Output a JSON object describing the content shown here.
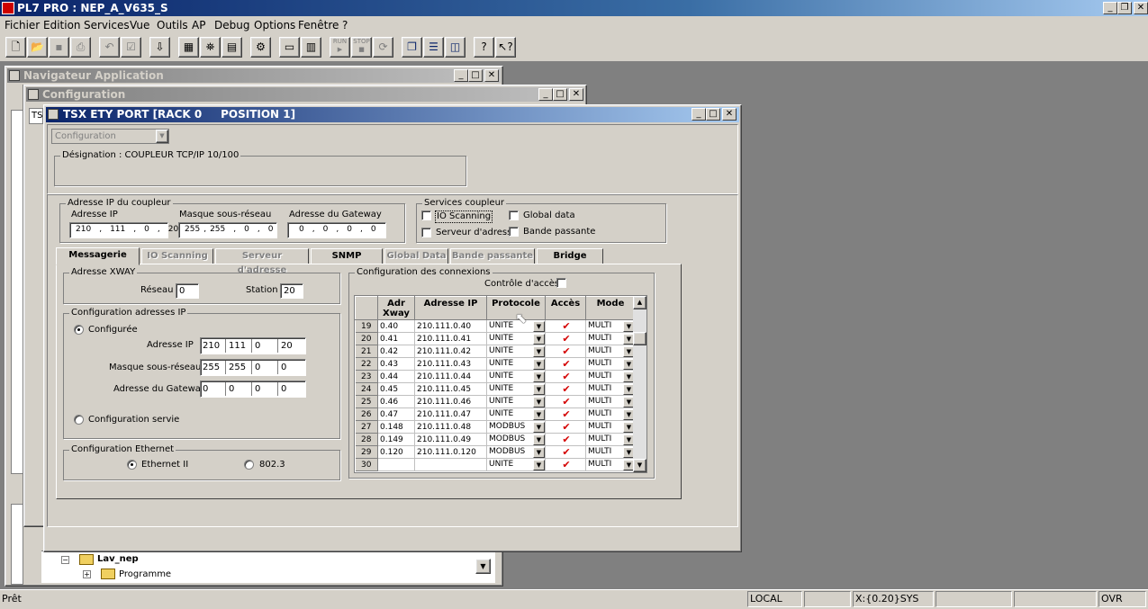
{
  "app": {
    "title": "PL7 PRO : NEP_A_V635_S"
  },
  "menu": [
    "Fichier",
    "Edition",
    "Services",
    "Vue",
    "Outils",
    "AP",
    "Debug",
    "Options",
    "Fenêtre",
    "?"
  ],
  "toolbar": {
    "run": "RUN",
    "stop": "STOP"
  },
  "nav_window": {
    "title": "Navigateur Application",
    "tree_root": "Lav_nep",
    "tree_child": "Programme",
    "cut_text": "TS"
  },
  "config_window": {
    "title": "Configuration"
  },
  "dialog": {
    "title": "TSX ETY PORT [RACK 0     POSITION 1]",
    "config_select": "Configuration",
    "designation": "Désignation : COUPLEUR TCP/IP 10/100",
    "ip_group": {
      "label": "Adresse IP du coupleur",
      "ip_label": "Adresse IP",
      "ip": [
        "210",
        "111",
        "0",
        "20"
      ],
      "mask_label": "Masque sous-réseau",
      "mask": [
        "255",
        "255",
        "0",
        "0"
      ],
      "gw_label": "Adresse du Gateway",
      "gw": [
        "0",
        "0",
        "0",
        "0"
      ]
    },
    "services": {
      "label": "Services coupleur",
      "io_scanning": "IO Scanning",
      "global_data": "Global data",
      "serveur": "Serveur d'adresse",
      "bande": "Bande passante"
    },
    "tabs": [
      "Messagerie",
      "IO Scanning",
      "Serveur d'adresse",
      "SNMP",
      "Global Data",
      "Bande passante",
      "Bridge"
    ],
    "xway": {
      "label": "Adresse XWAY",
      "reseau_label": "Réseau",
      "reseau": "0",
      "station_label": "Station",
      "station": "20"
    },
    "ipconf": {
      "label": "Configuration adresses IP",
      "configured": "Configurée",
      "ip_label": "Adresse IP",
      "ip": [
        "210",
        "111",
        "0",
        "20"
      ],
      "mask_label": "Masque sous-réseau",
      "mask": [
        "255",
        "255",
        "0",
        "0"
      ],
      "gw_label": "Adresse du Gateway",
      "gw": [
        "0",
        "0",
        "0",
        "0"
      ],
      "served": "Configuration servie"
    },
    "eth": {
      "label": "Configuration Ethernet",
      "eth2": "Ethernet II",
      "ieee": "802.3"
    },
    "connections": {
      "label": "Configuration des connexions",
      "access_ctrl": "Contrôle d'accès",
      "headers": {
        "adr1": "Adr",
        "adr2": "Xway",
        "ip": "Adresse IP",
        "proto": "Protocole",
        "access": "Accès",
        "mode": "Mode"
      },
      "rows": [
        {
          "n": "19",
          "xway": "0.40",
          "ip": "210.111.0.40",
          "proto": "UNITE",
          "mode": "MULTI"
        },
        {
          "n": "20",
          "xway": "0.41",
          "ip": "210.111.0.41",
          "proto": "UNITE",
          "mode": "MULTI"
        },
        {
          "n": "21",
          "xway": "0.42",
          "ip": "210.111.0.42",
          "proto": "UNITE",
          "mode": "MULTI"
        },
        {
          "n": "22",
          "xway": "0.43",
          "ip": "210.111.0.43",
          "proto": "UNITE",
          "mode": "MULTI"
        },
        {
          "n": "23",
          "xway": "0.44",
          "ip": "210.111.0.44",
          "proto": "UNITE",
          "mode": "MULTI"
        },
        {
          "n": "24",
          "xway": "0.45",
          "ip": "210.111.0.45",
          "proto": "UNITE",
          "mode": "MULTI"
        },
        {
          "n": "25",
          "xway": "0.46",
          "ip": "210.111.0.46",
          "proto": "UNITE",
          "mode": "MULTI"
        },
        {
          "n": "26",
          "xway": "0.47",
          "ip": "210.111.0.47",
          "proto": "UNITE",
          "mode": "MULTI"
        },
        {
          "n": "27",
          "xway": "0.148",
          "ip": "210.111.0.48",
          "proto": "MODBUS",
          "mode": "MULTI"
        },
        {
          "n": "28",
          "xway": "0.149",
          "ip": "210.111.0.49",
          "proto": "MODBUS",
          "mode": "MULTI"
        },
        {
          "n": "29",
          "xway": "0.120",
          "ip": "210.111.0.120",
          "proto": "MODBUS",
          "mode": "MULTI"
        },
        {
          "n": "30",
          "xway": "",
          "ip": "",
          "proto": "UNITE",
          "mode": "MULTI"
        }
      ]
    }
  },
  "statusbar": {
    "left": "Prêt",
    "local": "LOCAL",
    "addr": "X:{0.20}SYS",
    "ovr": "OVR"
  }
}
